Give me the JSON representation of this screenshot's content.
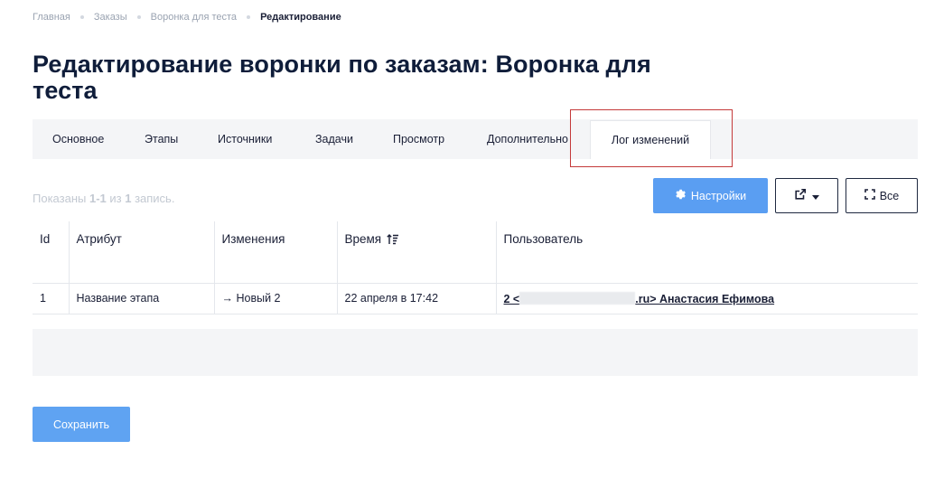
{
  "breadcrumb": {
    "items": [
      "Главная",
      "Заказы",
      "Воронка для теста"
    ],
    "current": "Редактирование"
  },
  "page": {
    "title": "Редактирование воронки по заказам: Воронка для теста"
  },
  "tabs": [
    {
      "label": "Основное",
      "active": false
    },
    {
      "label": "Этапы",
      "active": false
    },
    {
      "label": "Источники",
      "active": false
    },
    {
      "label": "Задачи",
      "active": false
    },
    {
      "label": "Просмотр",
      "active": false
    },
    {
      "label": "Дополнительно",
      "active": false
    },
    {
      "label": "Лог изменений",
      "active": true
    }
  ],
  "summary": {
    "prefix": "Показаны ",
    "range": "1-1",
    "middle": " из ",
    "total": "1",
    "suffix": " запись."
  },
  "toolbar": {
    "settings_label": "Настройки",
    "settings_icon": "gear-icon",
    "export_icon": "external-link-icon",
    "all_label": "Все",
    "all_icon": "expand-icon"
  },
  "table": {
    "columns": [
      "Id",
      "Атрибут",
      "Изменения",
      "Время",
      "Пользователь"
    ],
    "sort_column": "Время",
    "rows": [
      {
        "id": "1",
        "attribute": "Название этапа",
        "change": "→ Новый 2",
        "time": "22 апреля в 17:42",
        "user_prefix": "2 <",
        "user_suffix": ".ru> Анастасия Ефимова"
      }
    ]
  },
  "actions": {
    "save_label": "Сохранить"
  },
  "colors": {
    "primary": "#5a9ef2",
    "highlight": "#c43a3a",
    "title": "#0f1d3a",
    "tab_bg": "#f4f5f7"
  }
}
